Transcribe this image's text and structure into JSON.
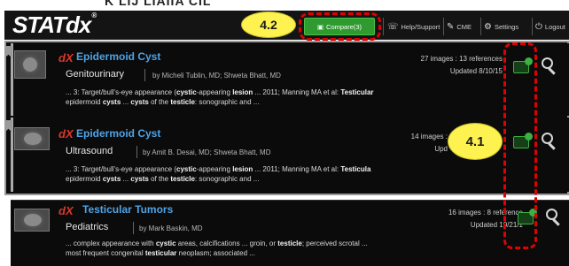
{
  "top_strip_text": "K LIJ LIAIIA CIL",
  "app": {
    "logo": "STATdx",
    "logo_mark": "®"
  },
  "callouts": {
    "compare": "4.2",
    "icons": "4.1"
  },
  "nav": {
    "compare_label": "Compare(3)",
    "help_label": "Help/Support",
    "cme_label": "CME",
    "settings_label": "Settings",
    "logout_label": "Logout"
  },
  "results": [
    {
      "dx_mark": "dX",
      "title": "Epidermoid Cyst",
      "category": "Genitourinary",
      "byline": "by Micheli Tublin, MD; Shweta Bhatt, MD",
      "counts": "27 images : 13 references",
      "updated": "Updated 8/10/15",
      "snippet_line1": [
        {
          "t": "... 3: Target/bull's-eye appearance (",
          "b": false
        },
        {
          "t": "cystic",
          "b": true
        },
        {
          "t": "-appearing ",
          "b": false
        },
        {
          "t": "lesion",
          "b": true
        },
        {
          "t": " ... 2011; Manning MA et al: ",
          "b": false
        },
        {
          "t": "Testicular",
          "b": true
        }
      ],
      "snippet_line2": [
        {
          "t": "epidermoid ",
          "b": false
        },
        {
          "t": "cysts",
          "b": true
        },
        {
          "t": " ... ",
          "b": false
        },
        {
          "t": "cysts",
          "b": true
        },
        {
          "t": " of the ",
          "b": false
        },
        {
          "t": "testicle",
          "b": true
        },
        {
          "t": ": sonographic and ...",
          "b": false
        }
      ]
    },
    {
      "dx_mark": "dX",
      "title": "Epidermoid Cyst",
      "category": "Ultrasound",
      "byline": "by Amit B. Desai, MD; Shweta Bhatt, MD",
      "counts": "14 images :",
      "updated": "Upd",
      "snippet_line1": [
        {
          "t": "... 3: Target/bull's-eye appearance (",
          "b": false
        },
        {
          "t": "cystic",
          "b": true
        },
        {
          "t": "-appearing ",
          "b": false
        },
        {
          "t": "lesion",
          "b": true
        },
        {
          "t": " ... 2011; Manning MA et al: ",
          "b": false
        },
        {
          "t": "Testicula",
          "b": true
        }
      ],
      "snippet_line2": [
        {
          "t": "epidermoid ",
          "b": false
        },
        {
          "t": "cysts",
          "b": true
        },
        {
          "t": " ... ",
          "b": false
        },
        {
          "t": "cysts",
          "b": true
        },
        {
          "t": " of the ",
          "b": false
        },
        {
          "t": "testicle",
          "b": true
        },
        {
          "t": ": sonographic and ...",
          "b": false
        }
      ]
    },
    {
      "dx_mark": "dX",
      "title": "Testicular Tumors",
      "category": "Pediatrics",
      "byline": "by Mark Baskin, MD",
      "counts": "16 images : 8 reference",
      "updated": "Updated 10/21/1",
      "snippet_line1": [
        {
          "t": "... complex appearance with ",
          "b": false
        },
        {
          "t": "cystic",
          "b": true
        },
        {
          "t": " areas, calcifications ... groin, or ",
          "b": false
        },
        {
          "t": "testicle",
          "b": true
        },
        {
          "t": "; perceived scrotal ...",
          "b": false
        }
      ],
      "snippet_line2": [
        {
          "t": "most frequent congenital ",
          "b": false
        },
        {
          "t": "testicular",
          "b": true
        },
        {
          "t": " neoplasm; associated ...",
          "b": false
        }
      ]
    }
  ],
  "colors": {
    "title_blue": "#4ea3e6",
    "dx_red": "#d93a2b",
    "compare_green": "#2f9a2f",
    "callout_yellow": "#fdf24f",
    "annotation_red": "#e00000"
  },
  "icons": {
    "compare": "compare-add-icon",
    "zoom": "magnifier-icon",
    "help": "help-icon",
    "cme": "cme-icon",
    "settings": "gear-icon",
    "logout": "power-icon"
  }
}
